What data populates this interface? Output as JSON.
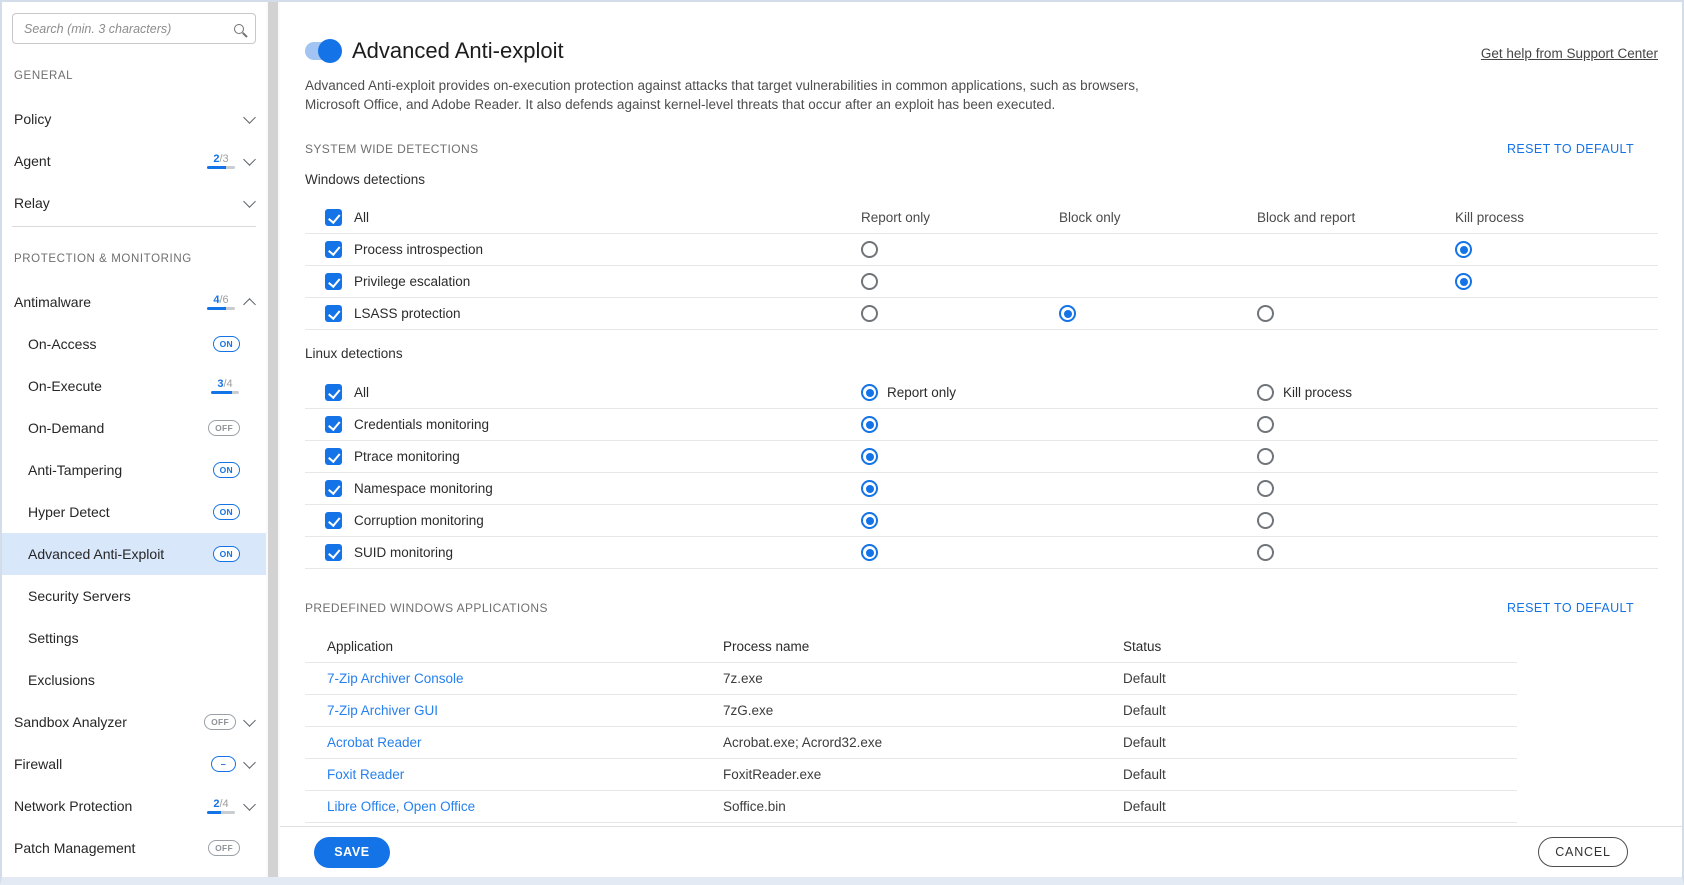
{
  "colors": {
    "accent": "#1473e6",
    "link_blue": "#2680ed",
    "selected_item_bg": "#d9e7fb"
  },
  "sidebar": {
    "search": {
      "placeholder": "Search (min. 3 characters)"
    },
    "groups": [
      {
        "label": "GENERAL",
        "items": [
          {
            "label": "Policy",
            "chevron": "down"
          },
          {
            "label": "Agent",
            "badge": {
              "type": "fraction",
              "text": "2/3",
              "num": 2,
              "den": 3
            },
            "chevron": "down"
          },
          {
            "label": "Relay",
            "chevron": "down"
          }
        ]
      },
      {
        "label": "PROTECTION & MONITORING",
        "items": [
          {
            "label": "Antimalware",
            "badge": {
              "type": "fraction",
              "text": "4/6",
              "num": 4,
              "den": 6
            },
            "chevron": "up"
          },
          {
            "label": "On-Access",
            "indent": true,
            "badge": {
              "type": "pill",
              "text": "ON",
              "state": "on"
            }
          },
          {
            "label": "On-Execute",
            "indent": true,
            "badge": {
              "type": "fraction",
              "text": "3/4",
              "num": 3,
              "den": 4
            }
          },
          {
            "label": "On-Demand",
            "indent": true,
            "badge": {
              "type": "pill",
              "text": "OFF",
              "state": "off"
            }
          },
          {
            "label": "Anti-Tampering",
            "indent": true,
            "badge": {
              "type": "pill",
              "text": "ON",
              "state": "on"
            }
          },
          {
            "label": "Hyper Detect",
            "indent": true,
            "badge": {
              "type": "pill",
              "text": "ON",
              "state": "on"
            }
          },
          {
            "label": "Advanced Anti-Exploit",
            "indent": true,
            "selected": true,
            "badge": {
              "type": "pill",
              "text": "ON",
              "state": "on"
            }
          },
          {
            "label": "Security Servers",
            "indent": true
          },
          {
            "label": "Settings",
            "indent": true
          },
          {
            "label": "Exclusions",
            "indent": true
          },
          {
            "label": "Sandbox Analyzer",
            "badge": {
              "type": "pill",
              "text": "OFF",
              "state": "off"
            },
            "chevron": "down"
          },
          {
            "label": "Firewall",
            "badge": {
              "type": "pill",
              "text": "–",
              "state": "partial"
            },
            "chevron": "down"
          },
          {
            "label": "Network Protection",
            "badge": {
              "type": "fraction",
              "text": "2/4",
              "num": 2,
              "den": 4
            },
            "chevron": "down"
          },
          {
            "label": "Patch Management",
            "badge": {
              "type": "pill",
              "text": "OFF",
              "state": "off"
            }
          }
        ]
      }
    ]
  },
  "main": {
    "toggle_on": true,
    "title": "Advanced Anti-exploit",
    "help_link": "Get help from Support Center",
    "description": "Advanced Anti-exploit provides on-execution protection against attacks that target vulnerabilities in common applications, such as browsers, Microsoft Office, and Adobe Reader. It also defends against kernel-level threats that occur after an exploit has been executed.",
    "system_wide": {
      "section_label": "SYSTEM WIDE DETECTIONS",
      "reset_label": "RESET TO DEFAULT",
      "windows": {
        "label": "Windows detections",
        "columns": [
          "Report only",
          "Block only",
          "Block and report",
          "Kill process"
        ],
        "rows": [
          {
            "label": "All",
            "checked": true,
            "is_column_header_row": true
          },
          {
            "label": "Process introspection",
            "checked": true,
            "radios": [
              "off",
              null,
              null,
              "on"
            ]
          },
          {
            "label": "Privilege escalation",
            "checked": true,
            "radios": [
              "off",
              null,
              null,
              "on"
            ]
          },
          {
            "label": "LSASS protection",
            "checked": true,
            "radios": [
              "off",
              "on",
              "off",
              null
            ]
          }
        ]
      },
      "linux": {
        "label": "Linux detections",
        "option_labels": [
          "Report only",
          "Kill process"
        ],
        "rows": [
          {
            "label": "All",
            "checked": true,
            "radios": [
              "on",
              "off"
            ],
            "show_option_labels": true
          },
          {
            "label": "Credentials monitoring",
            "checked": true,
            "radios": [
              "on",
              "off"
            ]
          },
          {
            "label": "Ptrace monitoring",
            "checked": true,
            "radios": [
              "on",
              "off"
            ]
          },
          {
            "label": "Namespace monitoring",
            "checked": true,
            "radios": [
              "on",
              "off"
            ]
          },
          {
            "label": "Corruption monitoring",
            "checked": true,
            "radios": [
              "on",
              "off"
            ]
          },
          {
            "label": "SUID monitoring",
            "checked": true,
            "radios": [
              "on",
              "off"
            ]
          }
        ]
      }
    },
    "apps": {
      "section_label": "PREDEFINED WINDOWS APPLICATIONS",
      "reset_label": "RESET TO DEFAULT",
      "columns": [
        "Application",
        "Process name",
        "Status"
      ],
      "rows": [
        {
          "application": "7-Zip Archiver Console",
          "process": "7z.exe",
          "status": "Default"
        },
        {
          "application": "7-Zip Archiver GUI",
          "process": "7zG.exe",
          "status": "Default"
        },
        {
          "application": "Acrobat Reader",
          "process": "Acrobat.exe; Acrord32.exe",
          "status": "Default"
        },
        {
          "application": "Foxit Reader",
          "process": "FoxitReader.exe",
          "status": "Default"
        },
        {
          "application": "Libre Office, Open Office",
          "process": "Soffice.bin",
          "status": "Default"
        }
      ]
    }
  },
  "footer": {
    "save_label": "SAVE",
    "cancel_label": "CANCEL"
  }
}
